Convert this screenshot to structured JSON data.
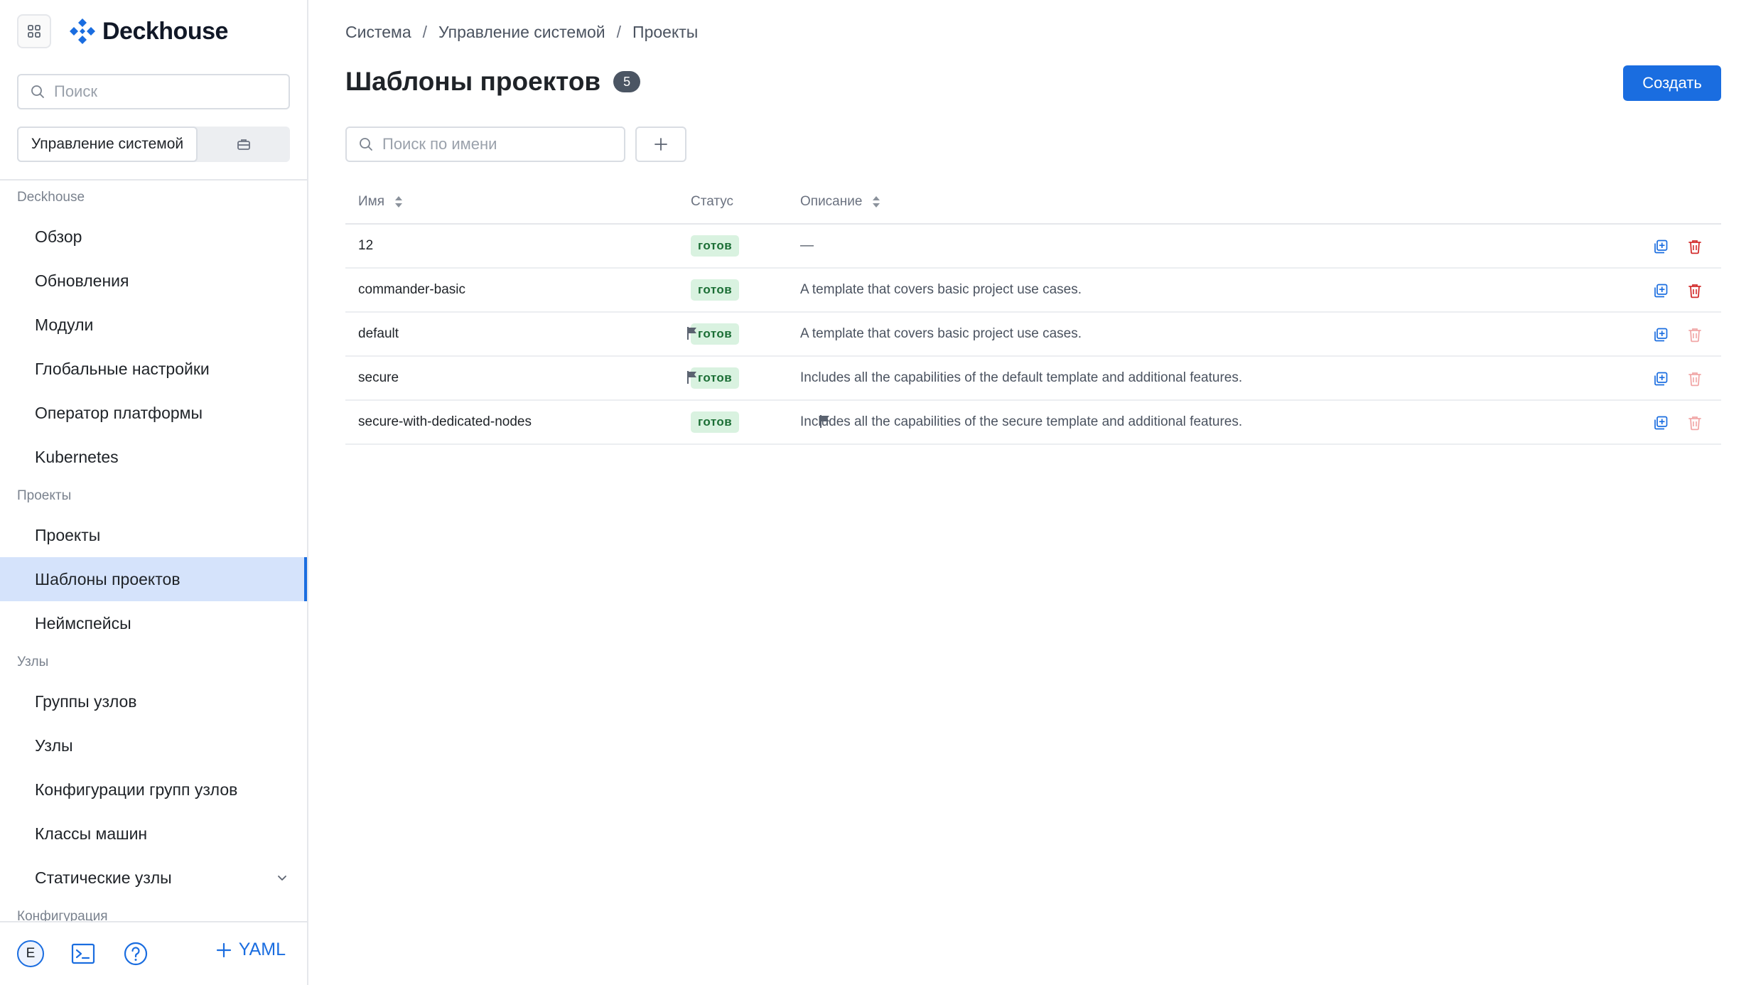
{
  "app": {
    "logo_text": "Deckhouse"
  },
  "sidebar": {
    "search_placeholder": "Поиск",
    "segments": {
      "active": "Управление системой"
    },
    "groups": [
      {
        "label": "Deckhouse",
        "items": [
          "Обзор",
          "Обновления",
          "Модули",
          "Глобальные настройки",
          "Оператор платформы",
          "Kubernetes"
        ]
      },
      {
        "label": "Проекты",
        "items": [
          "Проекты",
          "Шаблоны проектов",
          "Неймспейсы"
        ]
      },
      {
        "label": "Узлы",
        "items": [
          "Группы узлов",
          "Узлы",
          "Конфигурации групп узлов",
          "Классы машин",
          "Статические узлы"
        ]
      },
      {
        "label": "Конфигурация"
      }
    ],
    "active_item": "Шаблоны проектов",
    "bottom": {
      "avatar_letter": "E",
      "yaml_label": "YAML"
    }
  },
  "breadcrumb": [
    "Система",
    "Управление системой",
    "Проекты"
  ],
  "page": {
    "title": "Шаблоны проектов",
    "count": "5",
    "create_label": "Создать"
  },
  "filters": {
    "search_placeholder": "Поиск по имени"
  },
  "table": {
    "columns": {
      "name": "Имя",
      "status": "Статус",
      "description": "Описание"
    },
    "rows": [
      {
        "name": "12",
        "flag": false,
        "status": "готов",
        "description": "—",
        "delete_enabled": true
      },
      {
        "name": "commander-basic",
        "flag": false,
        "status": "готов",
        "description": "A template that covers basic project use cases.",
        "delete_enabled": true
      },
      {
        "name": "default",
        "flag": true,
        "status": "готов",
        "description": "A template that covers basic project use cases.",
        "delete_enabled": false
      },
      {
        "name": "secure",
        "flag": true,
        "status": "готов",
        "description": "Includes all the capabilities of the default template and additional features.",
        "delete_enabled": false
      },
      {
        "name": "secure-with-dedicated-nodes",
        "flag": true,
        "status": "готов",
        "description": "Includes all the capabilities of the secure template and additional features.",
        "delete_enabled": false
      }
    ]
  },
  "colors": {
    "accent": "#1a6de0",
    "active_bg": "#d5e3fb",
    "status_bg": "#d9f2e0",
    "status_text": "#1b6e35",
    "delete_active": "#d32f2f",
    "delete_disabled": "#f1a7a7"
  }
}
